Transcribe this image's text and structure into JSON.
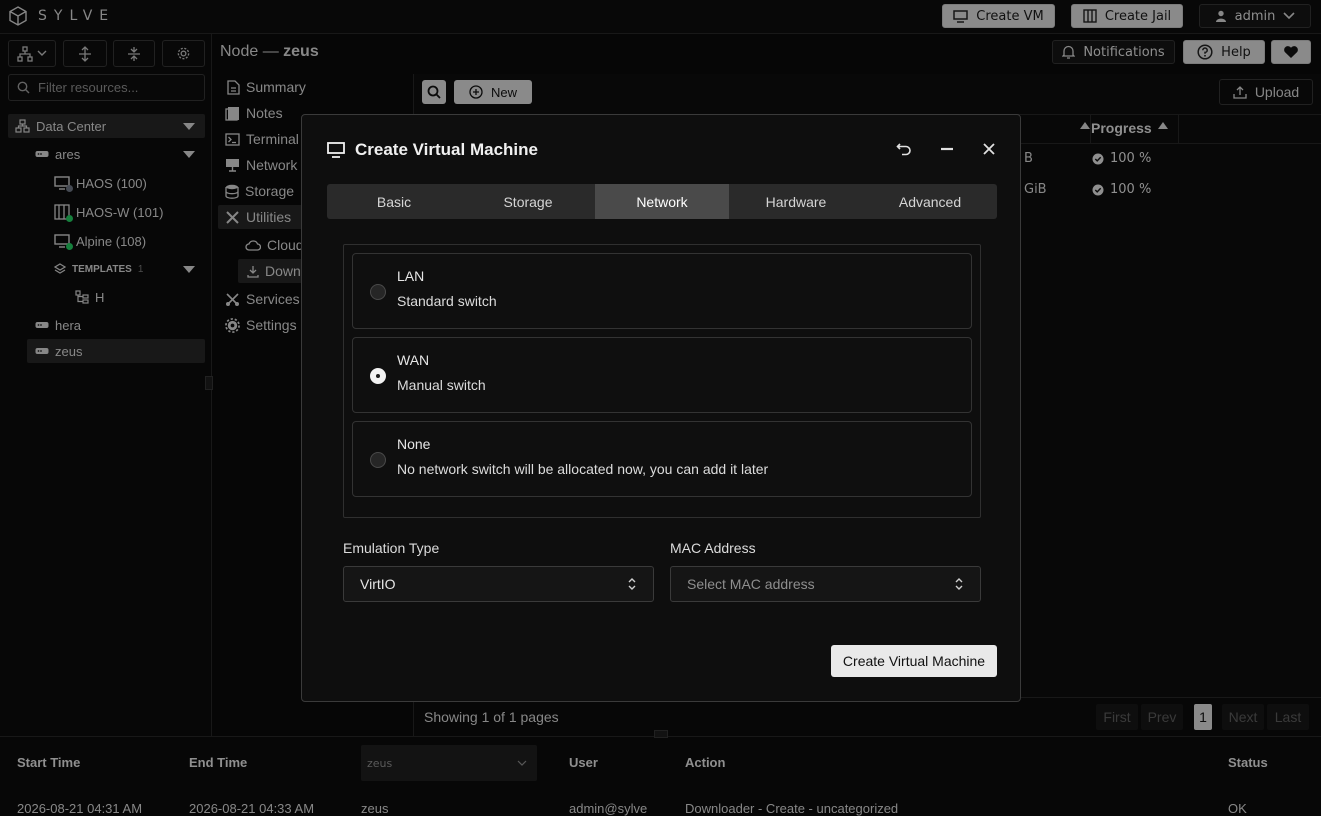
{
  "app": {
    "name": "SYLVE"
  },
  "topbar": {
    "create_vm": "Create VM",
    "create_jail": "Create Jail",
    "user": "admin"
  },
  "breadcrumb": {
    "prefix": "Node —",
    "node": "zeus"
  },
  "header_buttons": {
    "notifications": "Notifications",
    "help": "Help"
  },
  "sidebar": {
    "filter_placeholder": "Filter resources...",
    "datacenter": "Data Center",
    "nodes": [
      {
        "name": "ares",
        "children": [
          {
            "name": "HAOS (100)",
            "status": "stopped"
          },
          {
            "name": "HAOS-W (101)",
            "status": "running"
          },
          {
            "name": "Alpine (108)",
            "status": "running"
          }
        ]
      },
      {
        "name": "hera"
      },
      {
        "name": "zeus"
      }
    ],
    "templates_label": "TEMPLATES",
    "templates_count": "1",
    "template_item": "H"
  },
  "nav": {
    "summary": "Summary",
    "notes": "Notes",
    "terminal": "Terminal",
    "network": "Network",
    "storage": "Storage",
    "utilities": "Utilities",
    "cloud": "Cloud",
    "downloader": "Down",
    "services": "Services",
    "settings": "Settings"
  },
  "content": {
    "new_label": "New",
    "upload_label": "Upload",
    "progress_header": "Progress",
    "row_sizes": [
      "B",
      "GiB"
    ],
    "row_progress": [
      "100 %",
      "100 %"
    ],
    "showing": "Showing 1 of 1 pages",
    "pager": {
      "first": "First",
      "prev": "Prev",
      "page": "1",
      "next": "Next",
      "last": "Last"
    }
  },
  "bottom": {
    "headers": {
      "start": "Start Time",
      "end": "End Time",
      "node_filter": "zeus",
      "user": "User",
      "action": "Action",
      "status": "Status"
    },
    "row": {
      "start": "2026-08-21 04:31 AM",
      "end": "2026-08-21 04:33 AM",
      "node": "zeus",
      "user": "admin@sylve",
      "action": "Downloader - Create - uncategorized",
      "status": "OK"
    }
  },
  "modal": {
    "title": "Create Virtual Machine",
    "tabs": [
      "Basic",
      "Storage",
      "Network",
      "Hardware",
      "Advanced"
    ],
    "active_tab": "Network",
    "options": [
      {
        "title": "LAN",
        "subtitle": "Standard switch",
        "selected": false
      },
      {
        "title": "WAN",
        "subtitle": "Manual switch",
        "selected": true
      },
      {
        "title": "None",
        "subtitle": "No network switch will be allocated now, you can add it later",
        "selected": false
      }
    ],
    "emulation_label": "Emulation Type",
    "emulation_value": "VirtIO",
    "mac_label": "MAC Address",
    "mac_placeholder": "Select MAC address",
    "submit": "Create Virtual Machine"
  },
  "colors": {
    "running": "#22c55e",
    "stopped": "#6b7280",
    "accent": "#e9e9e9"
  }
}
